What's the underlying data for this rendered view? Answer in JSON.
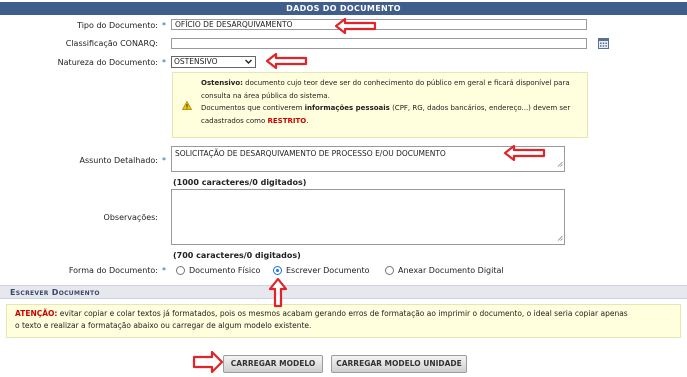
{
  "header_title": "Dados do Documento",
  "fields": {
    "tipo_label": "Tipo do Documento:",
    "tipo_value": "OFÍCIO DE DESARQUIVAMENTO",
    "classificacao_label": "Classificação CONARQ:",
    "classificacao_value": "",
    "natureza_label": "Natureza do Documento:",
    "natureza_value": "OSTENSIVO",
    "assunto_label": "Assunto Detalhado:",
    "assunto_value": "SOLICITAÇÃO DE DESARQUIVAMENTO DE PROCESSO E/OU DOCUMENTO",
    "assunto_counter": "(1000 caracteres/0 digitados)",
    "observacoes_label": "Observações:",
    "observacoes_value": "",
    "observacoes_counter": "(700 caracteres/0 digitados)",
    "forma_label": "Forma do Documento:",
    "required_mark": "*"
  },
  "natureza_note": {
    "ostensivo_term": "Ostensivo:",
    "ostensivo_text": " documento cujo teor deve ser do conhecimento do público em geral e ficará disponível para",
    "ostensivo_text2": "consulta na área pública do sistema.",
    "pessoais_pre": "Documentos que contiverem ",
    "pessoais_term": "informações pessoais",
    "pessoais_post": " (CPF, RG, dados bancários, endereço...) devem ser",
    "restrito_pre": "cadastrados como ",
    "restrito_term": "RESTRITO",
    "restrito_post": "."
  },
  "forma_options": [
    {
      "label": "Documento Físico",
      "selected": false
    },
    {
      "label": "Escrever Documento",
      "selected": true
    },
    {
      "label": "Anexar Documento Digital",
      "selected": false
    }
  ],
  "section_title": "Escrever Documento",
  "warning": {
    "term": "ATENÇÃO:",
    "text": " evitar copiar e colar textos já formatados, pois os mesmos acabam gerando erros de formatação ao imprimir o documento, o ideal seria copiar apenas",
    "text2": "o texto e realizar a formatação abaixo ou carregar de algum modelo existente."
  },
  "buttons": {
    "carregar_modelo": "CARREGAR MODELO",
    "carregar_modelo_unidade": "CARREGAR MODELO UNIDADE"
  },
  "colors": {
    "header_bg": "#3f5e8c",
    "annotation_arrow": "#e0242a",
    "note_bg": "#ffffdd",
    "restrito": "#cc0000"
  },
  "icons": [
    "calendar-icon",
    "warning-icon",
    "chevron-down-icon",
    "resize-grip-icon",
    "red-arrow-annotation"
  ]
}
